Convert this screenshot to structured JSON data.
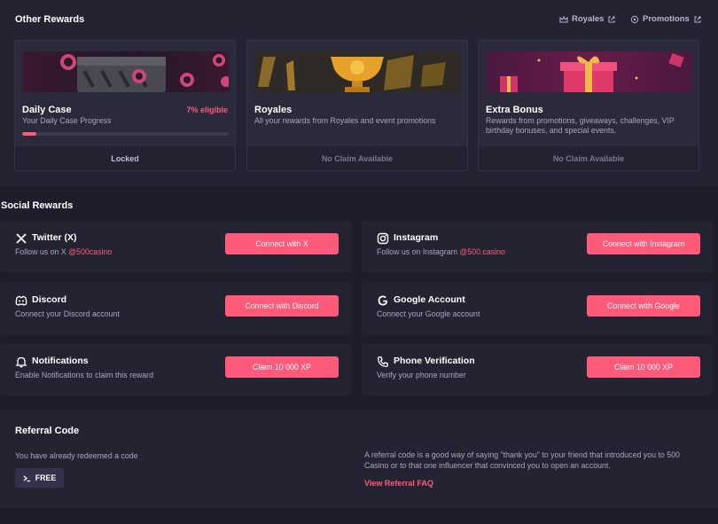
{
  "other_rewards": {
    "title": "Other Rewards",
    "links": [
      {
        "label": "Royales",
        "icon": "crown-icon"
      },
      {
        "label": "Promotions",
        "icon": "tag-icon"
      }
    ],
    "cards": [
      {
        "title": "Daily Case",
        "desc": "Your Daily Case Progress",
        "eligible": "7% eligible",
        "progress": 0.07,
        "footer": "Locked"
      },
      {
        "title": "Royales",
        "desc": "All your rewards from Royales and event promotions",
        "footer": "No Claim Available"
      },
      {
        "title": "Extra Bonus",
        "desc": "Rewards from promotions, giveaways, challenges, VIP birthday bonuses, and special events.",
        "footer": "No Claim Available"
      }
    ]
  },
  "social_rewards": {
    "title": "Social Rewards",
    "items": [
      {
        "name": "Twitter (X)",
        "desc": "Follow us on X ",
        "handle": "@500casino",
        "button": "Connect with X",
        "icon": "x-logo-icon"
      },
      {
        "name": "Instagram",
        "desc": "Follow us on Instagram ",
        "handle": "@500.casino",
        "button": "Connect with Instagram",
        "icon": "instagram-icon"
      },
      {
        "name": "Discord",
        "desc": "Connect your Discord account",
        "button": "Connect with Discord",
        "icon": "discord-icon"
      },
      {
        "name": "Google Account",
        "desc": "Connect your Google account",
        "button": "Connect with Google",
        "icon": "google-icon"
      },
      {
        "name": "Notifications",
        "desc": "Enable Notifications to claim this reward",
        "button": "Claim 10 000 XP",
        "icon": "bell-icon"
      },
      {
        "name": "Phone Verification",
        "desc": "Verify your phone number",
        "button": "Claim 10 000 XP",
        "icon": "phone-icon"
      }
    ]
  },
  "referral": {
    "title": "Referral Code",
    "status": "You have already redeemed a code",
    "code": "FREE",
    "info": "A referral code is a good way of saying \"thank you\" to your friend that introduced you to 500 Casino or to that one influencer that convinced you to open an account.",
    "faq_link": "View Referral FAQ"
  },
  "colors": {
    "accent": "#ff5a7a",
    "background": "#1e1d2b",
    "panel": "#242332",
    "card": "#2b2a3b"
  }
}
